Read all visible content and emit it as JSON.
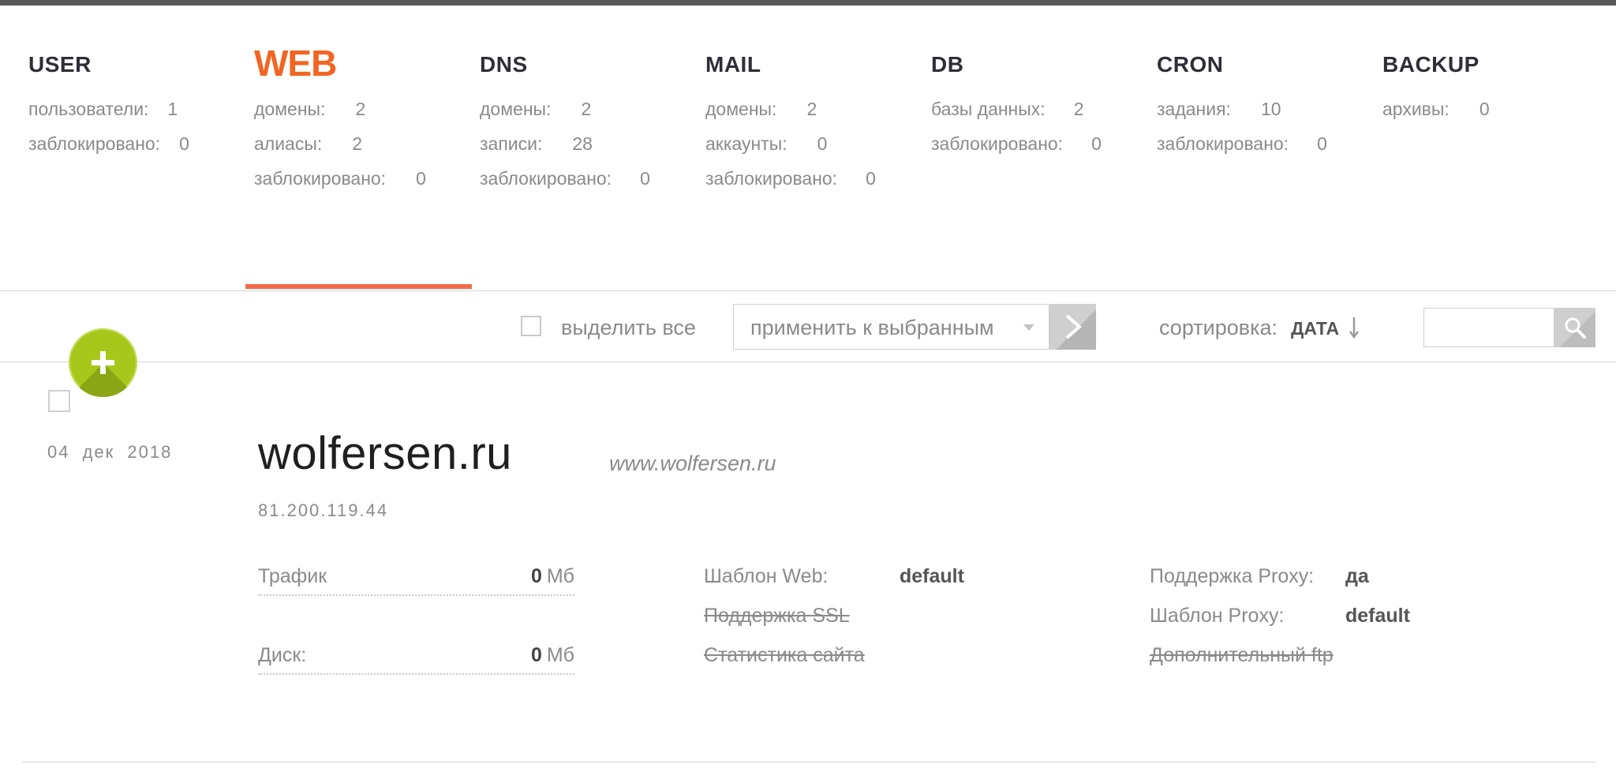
{
  "tabs": [
    {
      "id": "user",
      "title": "USER",
      "active": false,
      "stats": [
        {
          "label": "пользователи:",
          "value": "1"
        },
        {
          "label": "заблокировано:",
          "value": "0"
        }
      ]
    },
    {
      "id": "web",
      "title": "WEB",
      "active": true,
      "stats": [
        {
          "label": "домены:",
          "value": "2"
        },
        {
          "label": "алиасы:",
          "value": "2"
        },
        {
          "label": "заблокировано:",
          "value": "0"
        }
      ]
    },
    {
      "id": "dns",
      "title": "DNS",
      "active": false,
      "stats": [
        {
          "label": "домены:",
          "value": "2"
        },
        {
          "label": "записи:",
          "value": "28"
        },
        {
          "label": "заблокировано:",
          "value": "0"
        }
      ]
    },
    {
      "id": "mail",
      "title": "MAIL",
      "active": false,
      "stats": [
        {
          "label": "домены:",
          "value": "2"
        },
        {
          "label": "аккаунты:",
          "value": "0"
        },
        {
          "label": "заблокировано:",
          "value": "0"
        }
      ]
    },
    {
      "id": "db",
      "title": "DB",
      "active": false,
      "stats": [
        {
          "label": "базы данных:",
          "value": "2"
        },
        {
          "label": "заблокировано:",
          "value": "0"
        }
      ]
    },
    {
      "id": "cron",
      "title": "CRON",
      "active": false,
      "stats": [
        {
          "label": "задания:",
          "value": "10"
        },
        {
          "label": "заблокировано:",
          "value": "0"
        }
      ]
    },
    {
      "id": "backup",
      "title": "BACKUP",
      "active": false,
      "stats": [
        {
          "label": "архивы:",
          "value": "0"
        }
      ]
    }
  ],
  "toolbar": {
    "select_all_label": "выделить все",
    "bulk_action_value": "применить к выбранным",
    "sort_label": "сортировка:",
    "sort_value": "ДАТА",
    "search_value": ""
  },
  "item": {
    "date": "04 дек 2018",
    "domain": "wolfersen.ru",
    "alias": "www.wolfersen.ru",
    "ip": "81.200.119.44",
    "traffic": {
      "label": "Трафик",
      "value": "0",
      "unit": "Мб"
    },
    "disk": {
      "label": "Диск:",
      "value": "0",
      "unit": "Мб"
    },
    "web_template": {
      "label": "Шаблон Web:",
      "value": "default"
    },
    "ssl_support": {
      "label": "Поддержка SSL"
    },
    "site_stats": {
      "label": "Статистика сайта"
    },
    "proxy_support": {
      "label": "Поддержка Proxy:",
      "value": "да"
    },
    "proxy_template": {
      "label": "Шаблон Proxy:",
      "value": "default"
    },
    "extra_ftp": {
      "label": "Дополнительный ftp"
    }
  },
  "colors": {
    "accent": "#f26522",
    "add_button": "#a7c81a",
    "top_bar": "#595959"
  }
}
